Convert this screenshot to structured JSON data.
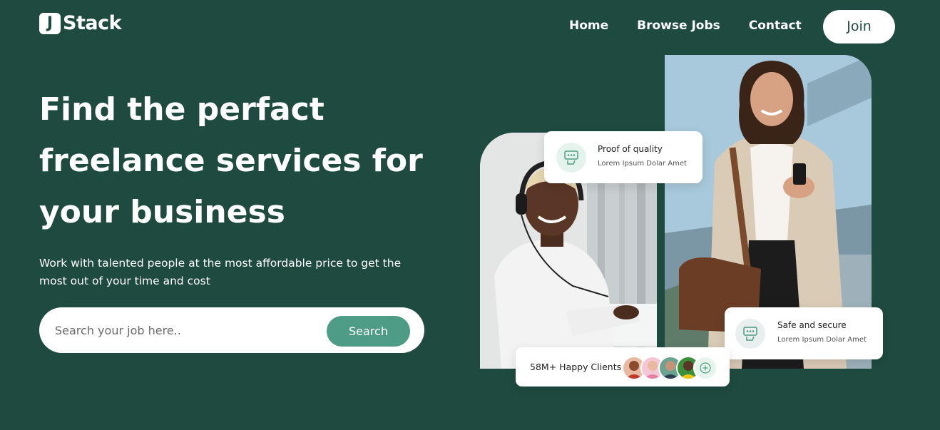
{
  "brand": {
    "logo_letter": "J",
    "logo_text": "Stack"
  },
  "nav": {
    "items": [
      "Home",
      "Browse Jobs",
      "Contact"
    ],
    "join_label": "Join"
  },
  "hero": {
    "title": "Find the perfact freelance services for your business",
    "subtitle": "Work with talented people at the most affordable price to get the most out of your time and cost"
  },
  "search": {
    "placeholder": "Search your job here..",
    "button_label": "Search"
  },
  "cards": {
    "quality": {
      "title": "Proof of quality",
      "desc": "Lorem Ipsum Dolar Amet",
      "icon": "badge-icon"
    },
    "secure": {
      "title": "Safe and secure",
      "desc": "Lorem Ipsum Dolar Amet",
      "icon": "badge-icon"
    },
    "clients": {
      "label": "58M+ Happy Clients",
      "icon": "plus-circle-icon"
    }
  },
  "colors": {
    "background": "#1f4a3f",
    "accent": "#4f9c86",
    "white": "#ffffff"
  }
}
